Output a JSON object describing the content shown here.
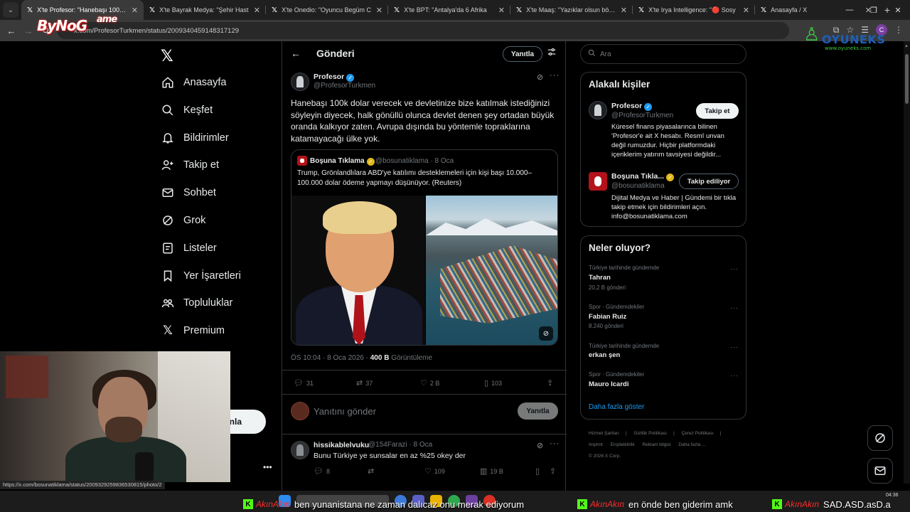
{
  "browser": {
    "tabs": [
      {
        "title": "X'te Profesor: \"Hanebaşı 100k d",
        "active": true
      },
      {
        "title": "X'te Bayrak Medya: \"Şehir Hast",
        "active": false
      },
      {
        "title": "X'te Onedio: \"Oyuncu Begüm C",
        "active": false
      },
      {
        "title": "X'te BPT: \"Antalya'da 6 Afrika",
        "active": false
      },
      {
        "title": "X'te Maaş: \"Yazıklar olsun böyle",
        "active": false
      },
      {
        "title": "X'te Irya Intelligence: \"🔴 Sosy",
        "active": false
      },
      {
        "title": "Anasayfa / X",
        "active": false
      }
    ],
    "url": "x.com/ProfesorTurkmen/status/2009340459148317129",
    "status_url": "https://x.com/bosunatiklama/status/2009329259836530815/photo/2",
    "profile_initial": "C"
  },
  "overlays": {
    "logo_left": "ByNoG",
    "logo_left_sup": "ame",
    "logo_right": "OYUNEKS",
    "logo_right_url": "www.oyuneks.com"
  },
  "nav": {
    "logo": "𝕏",
    "items": [
      {
        "label": "Anasayfa",
        "icon": "home-icon"
      },
      {
        "label": "Keşfet",
        "icon": "search-icon"
      },
      {
        "label": "Bildirimler",
        "icon": "bell-icon"
      },
      {
        "label": "Takip et",
        "icon": "follow-icon"
      },
      {
        "label": "Sohbet",
        "icon": "mail-icon"
      },
      {
        "label": "Grok",
        "icon": "grok-icon"
      },
      {
        "label": "Listeler",
        "icon": "list-icon"
      },
      {
        "label": "Yer İşaretleri",
        "icon": "bookmark-icon"
      },
      {
        "label": "Topluluklar",
        "icon": "people-icon"
      },
      {
        "label": "Premium",
        "icon": "x-premium-icon"
      }
    ],
    "post_button": "nla"
  },
  "main": {
    "title": "Gönderi",
    "reply_pill": "Yanıtla",
    "tweet": {
      "name": "Profesor",
      "handle": "@ProfesorTurkmen",
      "text": "Hanebaşı 100k dolar verecek ve devletinize bize katılmak istediğinizi söyleyin diyecek, halk gönüllü olunca devlet denen şey ortadan büyük oranda kalkıyor zaten. Avrupa dışında bu yöntemle topraklarına katamayacağı ülke yok.",
      "quote": {
        "name": "Boşuna Tıklama",
        "handle": "@bosunatiklama · 8 Oca",
        "text": "Trump, Grönlandlılara ABD'ye katılımı desteklemeleri için kişi başı 10.000–100.000 dolar ödeme yapmayı düşünüyor. (Reuters)"
      },
      "meta_time": "ÖS 10:04 · 8 Oca 2026 · ",
      "meta_views_value": "400 B",
      "meta_views_label": " Görüntüleme",
      "stats": {
        "replies": "31",
        "reposts": "37",
        "likes": "2 B",
        "bookmarks": "103"
      }
    },
    "reply_placeholder": "Yanıtını gönder",
    "reply_button": "Yanıtla",
    "reply": {
      "name": "hissikablelvuku",
      "handle": "@154Farazi · 8 Oca",
      "text": "Bunu Türkiye ye sunsalar en az %25 okey der",
      "stats": {
        "replies": "8",
        "reposts": "",
        "likes": "109",
        "views": "19 B"
      }
    }
  },
  "right": {
    "search_placeholder": "Ara",
    "related_title": "Alakalı kişiler",
    "people": [
      {
        "name": "Profesor",
        "handle": "@ProfesorTurkmen",
        "button": "Takip et",
        "bio": "Küresel finans piyasalarınca bilinen 'Profesor'e ait X hesabı. Resmî unvan değil rumuzdur. Hiçbir platformdaki içeriklerim yatırım tavsiyesi değildir..."
      },
      {
        "name": "Boşuna Tıkla...",
        "handle": "@bosunatiklama",
        "button": "Takip ediliyor",
        "bio": "Dijital Medya ve Haber | Gündemi bir tıkla takip etmek için bildirimleri açın. info@bosunatiklama.com"
      }
    ],
    "trends_title": "Neler oluyor?",
    "trends": [
      {
        "category": "Türkiye tarihinde gündemde",
        "name": "Tahran",
        "count": "20,2 B gönderi"
      },
      {
        "category": "Spor · Gündemdekiler",
        "name": "Fabian Ruiz",
        "count": "8.240 gönderi"
      },
      {
        "category": "Türkiye tarihinde gündemde",
        "name": "erkan şen",
        "count": ""
      },
      {
        "category": "Spor · Gündemdekiler",
        "name": "Mauro Icardi",
        "count": ""
      }
    ],
    "show_more": "Daha fazla göster",
    "footer": [
      "Hizmet Şartları",
      "Gizlilik Politikası",
      "Çerez Politikası",
      "Imprint",
      "Erişilebilirlik",
      "Reklam bilgisi",
      "Daha fazla ...",
      "© 2026 X Corp."
    ]
  },
  "stream_chat": [
    {
      "user": "AkınAkın",
      "message": "ben yunanistana ne zaman dalıcaz onu merak ediyorum"
    },
    {
      "user": "AkınAkın",
      "message": "en önde ben giderim amk"
    },
    {
      "user": "AkınAkın",
      "message": "SAD.ASD.asD.a"
    }
  ],
  "clock": {
    "time": "04:36"
  }
}
